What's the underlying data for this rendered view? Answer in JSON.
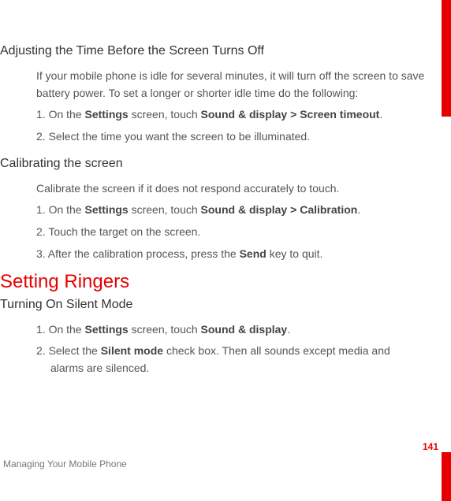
{
  "page_number": "141",
  "footer": "Managing Your Mobile Phone",
  "section1": {
    "title": "Adjusting the Time Before the Screen Turns Off",
    "intro": "If your mobile phone is idle for several minutes, it will turn off the screen to save battery power. To set a longer or shorter idle time do the following:",
    "step1_prefix": "1. On the ",
    "step1_b1": "Settings",
    "step1_mid": " screen, touch ",
    "step1_b2": "Sound & display",
    "step1_gt": " > ",
    "step1_b3": "Screen timeout",
    "step1_suffix": ".",
    "step2": "2. Select the time  you want the screen to be illuminated."
  },
  "section2": {
    "title": "Calibrating the screen",
    "intro": "Calibrate the screen if it does not respond accurately to touch.",
    "step1_prefix": "1. On the ",
    "step1_b1": "Settings",
    "step1_mid": " screen, touch ",
    "step1_b2": "Sound & display",
    "step1_gt": "  > ",
    "step1_b3": "Calibration",
    "step1_suffix": ".",
    "step2": "2. Touch the target on the screen.",
    "step3_prefix": "3. After the calibration process, press the ",
    "step3_b1": "Send",
    "step3_suffix": " key to quit."
  },
  "section3": {
    "title": "Setting Ringers"
  },
  "section4": {
    "title": "Turning On Silent Mode",
    "step1_prefix": "1. On the ",
    "step1_b1": "Settings",
    "step1_mid": " screen, touch ",
    "step1_b2": "Sound & display",
    "step1_suffix": ".",
    "step2_prefix": "2. Select the ",
    "step2_b1": "Silent mode",
    "step2_mid": " check box. Then all sounds except media and ",
    "step2_cont": "alarms are silenced."
  }
}
